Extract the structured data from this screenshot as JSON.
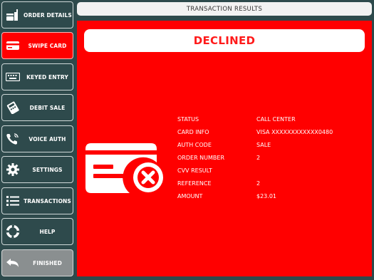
{
  "sidebar": {
    "items": [
      {
        "label": "ORDER DETAILS",
        "icon": "order-details-icon"
      },
      {
        "label": "SWIPE CARD",
        "icon": "credit-card-icon"
      },
      {
        "label": "KEYED ENTRY",
        "icon": "keyboard-icon"
      },
      {
        "label": "DEBIT SALE",
        "icon": "pos-terminal-icon"
      },
      {
        "label": "VOICE AUTH",
        "icon": "phone-icon"
      },
      {
        "label": "SETTINGS",
        "icon": "gear-icon"
      },
      {
        "label": "TRANSACTIONS",
        "icon": "list-icon"
      },
      {
        "label": "HELP",
        "icon": "lifebuoy-icon"
      },
      {
        "label": "FINISHED",
        "icon": "return-arrow-icon"
      }
    ],
    "active_index": 1
  },
  "header": {
    "title": "TRANSACTION RESULTS"
  },
  "result": {
    "status_banner": "DECLINED",
    "icon": "card-declined-icon"
  },
  "details": [
    {
      "label": "STATUS",
      "value": "CALL CENTER"
    },
    {
      "label": "CARD INFO",
      "value": "VISA XXXXXXXXXXXX0480"
    },
    {
      "label": "AUTH CODE",
      "value": "SALE"
    },
    {
      "label": "ORDER NUMBER",
      "value": "2"
    },
    {
      "label": "CVV RESULT",
      "value": ""
    },
    {
      "label": "REFERENCE",
      "value": "2"
    },
    {
      "label": "AMOUNT",
      "value": "$23.01"
    }
  ],
  "colors": {
    "background": "#2e4a4c",
    "panel": "#ff0000",
    "active_button": "#ff0000",
    "finished_button": "#8a8f90",
    "declined_text": "#ff1a1a"
  }
}
